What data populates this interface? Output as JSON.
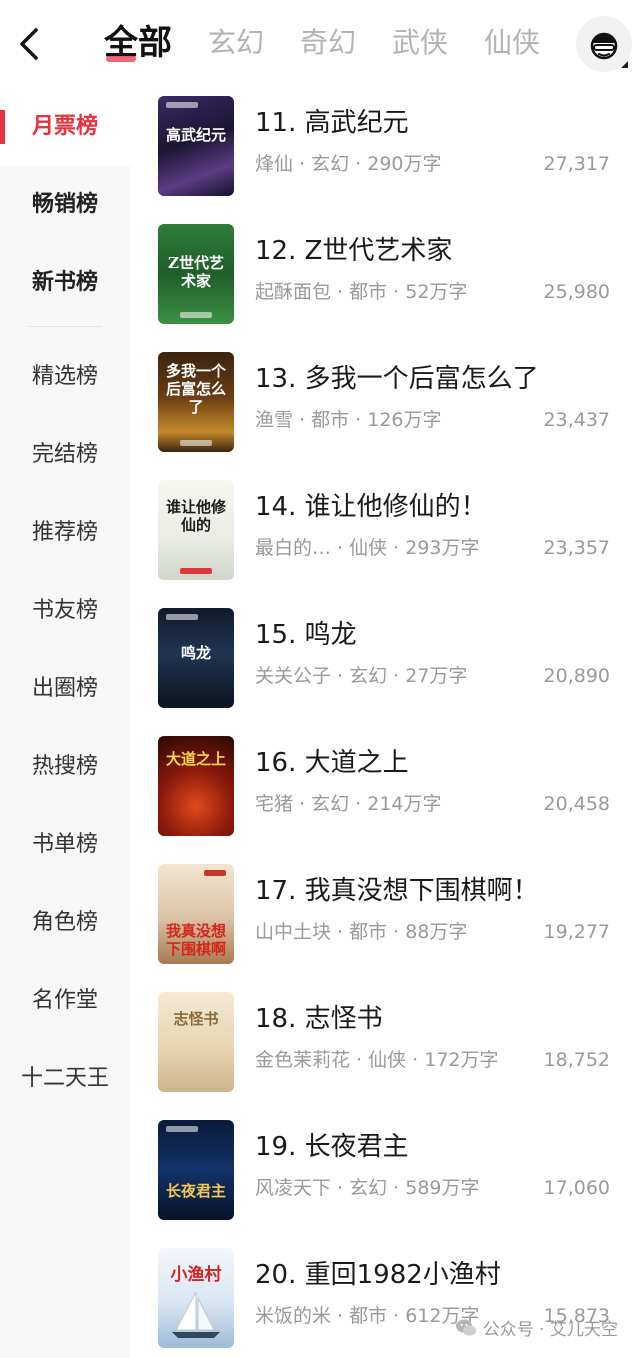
{
  "header": {
    "back_icon": "chevron-left-icon",
    "tabs": [
      {
        "label": "全部",
        "active": true
      },
      {
        "label": "玄幻",
        "active": false
      },
      {
        "label": "奇幻",
        "active": false
      },
      {
        "label": "武侠",
        "active": false
      },
      {
        "label": "仙侠",
        "active": false
      }
    ],
    "avatar_icon": "user-avatar-icon"
  },
  "sidebar": {
    "items": [
      {
        "label": "月票榜",
        "active": true
      },
      {
        "label": "畅销榜",
        "active": false
      },
      {
        "label": "新书榜",
        "active": false
      },
      {
        "label": "精选榜",
        "active": false
      },
      {
        "label": "完结榜",
        "active": false
      },
      {
        "label": "推荐榜",
        "active": false
      },
      {
        "label": "书友榜",
        "active": false
      },
      {
        "label": "出圈榜",
        "active": false
      },
      {
        "label": "热搜榜",
        "active": false
      },
      {
        "label": "书单榜",
        "active": false
      },
      {
        "label": "角色榜",
        "active": false
      },
      {
        "label": "名作堂",
        "active": false
      },
      {
        "label": "十二天王",
        "active": false
      }
    ]
  },
  "books": [
    {
      "title": "11. 高武纪元",
      "meta": "烽仙 · 玄幻 · 290万字",
      "votes": "27,317",
      "cover_text": "高武纪元"
    },
    {
      "title": "12. Z世代艺术家",
      "meta": "起酥面包 · 都市 · 52万字",
      "votes": "25,980",
      "cover_text": "Z世代艺术家"
    },
    {
      "title": "13. 多我一个后富怎么了",
      "meta": "渔雪 · 都市 · 126万字",
      "votes": "23,437",
      "cover_text": "多我一个后富怎么了"
    },
    {
      "title": "14. 谁让他修仙的！",
      "meta": "最白的… · 仙侠 · 293万字",
      "votes": "23,357",
      "cover_text": "谁让他修仙的"
    },
    {
      "title": "15. 鸣龙",
      "meta": "关关公子 · 玄幻 · 27万字",
      "votes": "20,890",
      "cover_text": "鸣龙"
    },
    {
      "title": "16. 大道之上",
      "meta": "宅猪 · 玄幻 · 214万字",
      "votes": "20,458",
      "cover_text": "大道之上"
    },
    {
      "title": "17. 我真没想下围棋啊！",
      "meta": "山中土块 · 都市 · 88万字",
      "votes": "19,277",
      "cover_text": "我真没想下围棋啊"
    },
    {
      "title": "18. 志怪书",
      "meta": "金色茉莉花 · 仙侠 · 172万字",
      "votes": "18,752",
      "cover_text": "志怪书"
    },
    {
      "title": "19. 长夜君主",
      "meta": "风凌天下 · 玄幻 · 589万字",
      "votes": "17,060",
      "cover_text": "长夜君主"
    },
    {
      "title": "20. 重回1982小渔村",
      "meta": "米饭的米 · 都市 · 612万字",
      "votes": "15,873",
      "cover_text": "小渔村"
    }
  ],
  "watermark": {
    "text": "公众号 · 艾儿天空",
    "icon": "wechat-icon"
  },
  "colors": {
    "accent": "#e5323e",
    "text_primary": "#1a1a1a",
    "text_secondary": "#9a9a9a",
    "sidebar_bg": "#f7f7f7"
  }
}
